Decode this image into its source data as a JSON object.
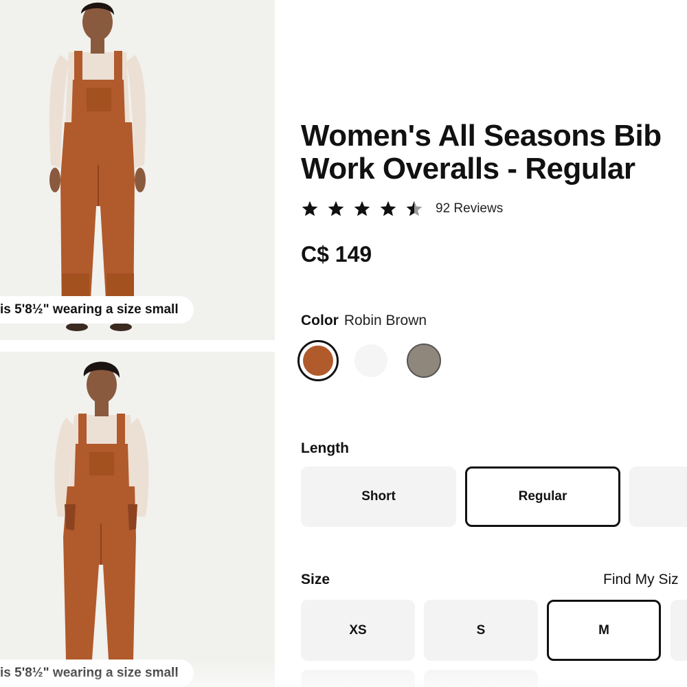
{
  "gallery": {
    "images": [
      {
        "caption": "is 5'8½\" wearing a size small"
      },
      {
        "caption": "is 5'8½\" wearing a size small"
      }
    ]
  },
  "product": {
    "title": "Women's All Seasons Bib Work Overalls - Regular",
    "rating": 4.5,
    "rating_max": 5,
    "reviews_label": "92 Reviews",
    "price": "C$ 149"
  },
  "color": {
    "label": "Color",
    "selected": "Robin Brown",
    "swatches": [
      {
        "name": "Robin Brown",
        "hex": "#b15a2c",
        "selected": true
      },
      {
        "name": "white",
        "hex": "#f4f5f4",
        "selected": false
      },
      {
        "name": "grey",
        "hex": "#8f877c",
        "selected": false
      }
    ]
  },
  "length": {
    "label": "Length",
    "options": [
      {
        "label": "Short",
        "selected": false
      },
      {
        "label": "Regular",
        "selected": true
      },
      {
        "label": "",
        "selected": false
      }
    ]
  },
  "size": {
    "label": "Size",
    "find_label": "Find My Siz",
    "options": [
      {
        "label": "XS",
        "selected": false
      },
      {
        "label": "S",
        "selected": false
      },
      {
        "label": "M",
        "selected": true
      },
      {
        "label": "",
        "selected": false
      }
    ]
  },
  "colors": {
    "overall": "#b15a2c",
    "overall_dark": "#8c4320",
    "shirt": "#ece0d4",
    "skin": "#8a5a3e",
    "hair": "#1c1410",
    "photo_bg": "#f1f1ee"
  }
}
